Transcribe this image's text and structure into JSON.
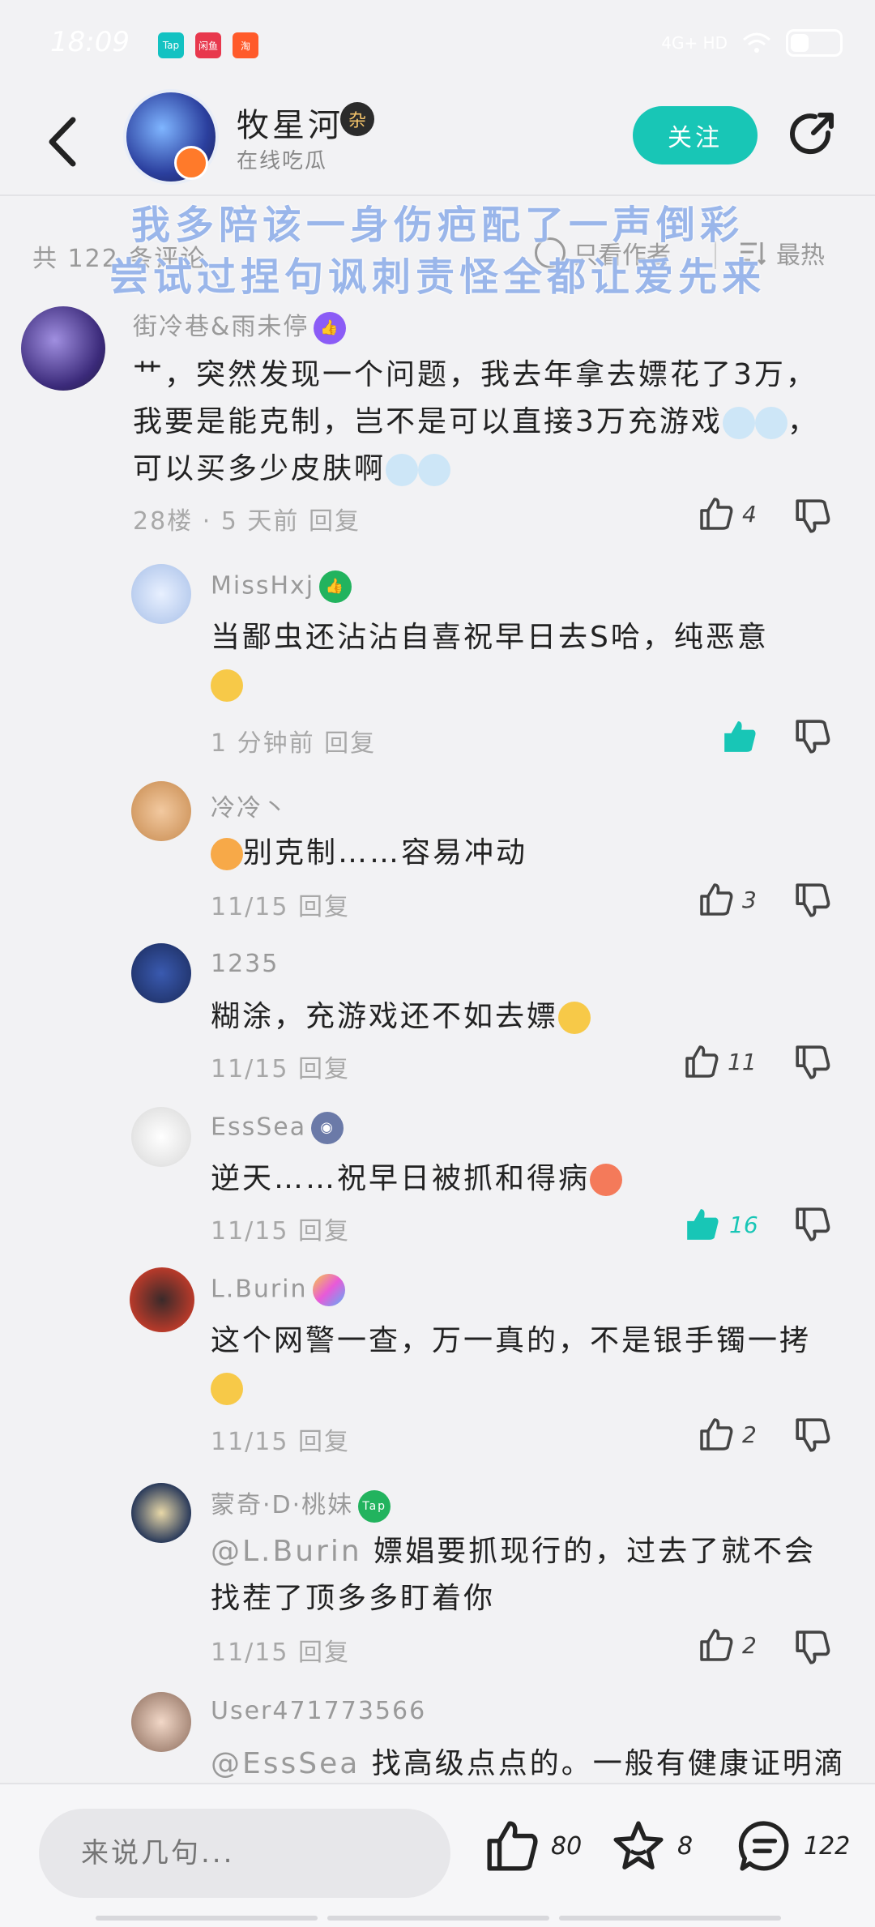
{
  "status_bar": {
    "time": "18:09",
    "network": "4G+ HD",
    "apps": [
      "Tap",
      "闲鱼",
      "淘"
    ]
  },
  "header": {
    "author_name": "牧星河",
    "author_badge": "杂",
    "author_status": "在线吃瓜",
    "follow_label": "关注"
  },
  "filter_bar": {
    "count_label": "共 122 条评论",
    "author_only_label": "只看作者",
    "sort_label": "最热"
  },
  "overlay_text": {
    "line1": "我多陪该一身伤疤配了一声倒彩",
    "line2": "尝试过捏句讽刺责怪全都让爱先来"
  },
  "comments": [
    {
      "name": "街冷巷&雨未停",
      "text": "艹，突然发现一个问题，我去年拿去嫖花了3万，我要是能克制，岂不是可以直接3万充游戏",
      "text2": "，可以买多少皮肤啊",
      "meta": "28楼 · 5 天前  回复",
      "likes": "4",
      "liked": false
    },
    {
      "name": "MissHxj",
      "text": "当鄙虫还沾沾自喜祝早日去S哈，纯恶意",
      "meta": "1 分钟前  回复",
      "likes": "",
      "liked": true
    },
    {
      "name": "冷冷丶",
      "text": "别克制……容易冲动",
      "meta": "11/15  回复",
      "likes": "3",
      "liked": false
    },
    {
      "name": "1235",
      "text": "糊涂，充游戏还不如去嫖",
      "meta": "11/15  回复",
      "likes": "11",
      "liked": false
    },
    {
      "name": "EssSea",
      "text": "逆天……祝早日被抓和得病",
      "meta": "11/15  回复",
      "likes": "16",
      "liked": true
    },
    {
      "name": "L.Burin",
      "text": "这个网警一查，万一真的，不是银手镯一拷",
      "meta": "11/15  回复",
      "likes": "2",
      "liked": false
    },
    {
      "name": "蒙奇·D·桃妹",
      "mention": "@L.Burin",
      "text": "嫖娼要抓现行的，过去了就不会找茬了顶多多盯着你",
      "meta": "11/15  回复",
      "likes": "2",
      "liked": false
    },
    {
      "name": "User471773566",
      "mention": "@EssSea",
      "text": "找高级点点的。一般有健康证明滴",
      "meta": "",
      "likes": "",
      "liked": false
    }
  ],
  "bottom_bar": {
    "placeholder": "来说几句...",
    "likes": "80",
    "favorites": "8",
    "comments": "122"
  },
  "colors": {
    "accent": "#18c6b6",
    "overlay": "#9ab6ea"
  }
}
